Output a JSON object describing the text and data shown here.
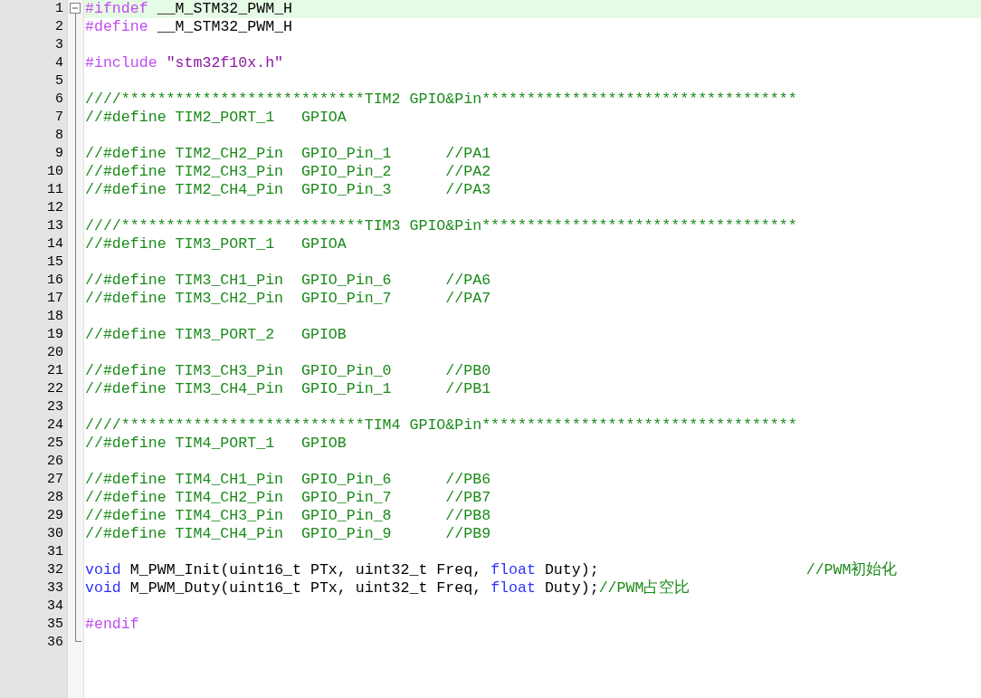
{
  "fold_region": {
    "expanded": true
  },
  "lines": [
    {
      "number": "1",
      "highlighted": true,
      "tokens": [
        {
          "kind": "preprocessor",
          "text": "#ifndef"
        },
        {
          "kind": "plain",
          "text": " __M_STM32_PWM_H"
        }
      ]
    },
    {
      "number": "2",
      "highlighted": false,
      "tokens": [
        {
          "kind": "preprocessor",
          "text": "#define"
        },
        {
          "kind": "plain",
          "text": " __M_STM32_PWM_H"
        }
      ]
    },
    {
      "number": "3",
      "highlighted": false
    },
    {
      "number": "4",
      "highlighted": false,
      "tokens": [
        {
          "kind": "preprocessor",
          "text": "#include "
        },
        {
          "kind": "string",
          "text": "\"stm32f10x.h\""
        }
      ]
    },
    {
      "number": "5",
      "highlighted": false
    },
    {
      "number": "6",
      "highlighted": false,
      "tokens": [
        {
          "kind": "comment",
          "text": "////***************************TIM2 GPIO&Pin***********************************"
        }
      ]
    },
    {
      "number": "7",
      "highlighted": false,
      "tokens": [
        {
          "kind": "comment",
          "text": "//#define TIM2_PORT_1   GPIOA"
        }
      ]
    },
    {
      "number": "8",
      "highlighted": false
    },
    {
      "number": "9",
      "highlighted": false,
      "tokens": [
        {
          "kind": "comment",
          "text": "//#define TIM2_CH2_Pin  GPIO_Pin_1      //PA1"
        }
      ]
    },
    {
      "number": "10",
      "highlighted": false,
      "tokens": [
        {
          "kind": "comment",
          "text": "//#define TIM2_CH3_Pin  GPIO_Pin_2      //PA2"
        }
      ]
    },
    {
      "number": "11",
      "highlighted": false,
      "tokens": [
        {
          "kind": "comment",
          "text": "//#define TIM2_CH4_Pin  GPIO_Pin_3      //PA3"
        }
      ]
    },
    {
      "number": "12",
      "highlighted": false
    },
    {
      "number": "13",
      "highlighted": false,
      "tokens": [
        {
          "kind": "comment",
          "text": "////***************************TIM3 GPIO&Pin***********************************"
        }
      ]
    },
    {
      "number": "14",
      "highlighted": false,
      "tokens": [
        {
          "kind": "comment",
          "text": "//#define TIM3_PORT_1   GPIOA"
        }
      ]
    },
    {
      "number": "15",
      "highlighted": false
    },
    {
      "number": "16",
      "highlighted": false,
      "tokens": [
        {
          "kind": "comment",
          "text": "//#define TIM3_CH1_Pin  GPIO_Pin_6      //PA6"
        }
      ]
    },
    {
      "number": "17",
      "highlighted": false,
      "tokens": [
        {
          "kind": "comment",
          "text": "//#define TIM3_CH2_Pin  GPIO_Pin_7      //PA7"
        }
      ]
    },
    {
      "number": "18",
      "highlighted": false
    },
    {
      "number": "19",
      "highlighted": false,
      "tokens": [
        {
          "kind": "comment",
          "text": "//#define TIM3_PORT_2   GPIOB"
        }
      ]
    },
    {
      "number": "20",
      "highlighted": false
    },
    {
      "number": "21",
      "highlighted": false,
      "tokens": [
        {
          "kind": "comment",
          "text": "//#define TIM3_CH3_Pin  GPIO_Pin_0      //PB0"
        }
      ]
    },
    {
      "number": "22",
      "highlighted": false,
      "tokens": [
        {
          "kind": "comment",
          "text": "//#define TIM3_CH4_Pin  GPIO_Pin_1      //PB1"
        }
      ]
    },
    {
      "number": "23",
      "highlighted": false
    },
    {
      "number": "24",
      "highlighted": false,
      "tokens": [
        {
          "kind": "comment",
          "text": "////***************************TIM4 GPIO&Pin***********************************"
        }
      ]
    },
    {
      "number": "25",
      "highlighted": false,
      "tokens": [
        {
          "kind": "comment",
          "text": "//#define TIM4_PORT_1   GPIOB"
        }
      ]
    },
    {
      "number": "26",
      "highlighted": false
    },
    {
      "number": "27",
      "highlighted": false,
      "tokens": [
        {
          "kind": "comment",
          "text": "//#define TIM4_CH1_Pin  GPIO_Pin_6      //PB6"
        }
      ]
    },
    {
      "number": "28",
      "highlighted": false,
      "tokens": [
        {
          "kind": "comment",
          "text": "//#define TIM4_CH2_Pin  GPIO_Pin_7      //PB7"
        }
      ]
    },
    {
      "number": "29",
      "highlighted": false,
      "tokens": [
        {
          "kind": "comment",
          "text": "//#define TIM4_CH3_Pin  GPIO_Pin_8      //PB8"
        }
      ]
    },
    {
      "number": "30",
      "highlighted": false,
      "tokens": [
        {
          "kind": "comment",
          "text": "//#define TIM4_CH4_Pin  GPIO_Pin_9      //PB9"
        }
      ]
    },
    {
      "number": "31",
      "highlighted": false
    },
    {
      "number": "32",
      "highlighted": false,
      "tokens": [
        {
          "kind": "keyword",
          "text": "void"
        },
        {
          "kind": "plain",
          "text": " M_PWM_Init(uint16_t PTx, uint32_t Freq, "
        },
        {
          "kind": "keyword",
          "text": "float"
        },
        {
          "kind": "plain",
          "text": " Duty);                       "
        },
        {
          "kind": "comment",
          "text": "//PWM初始化"
        }
      ]
    },
    {
      "number": "33",
      "highlighted": false,
      "tokens": [
        {
          "kind": "keyword",
          "text": "void"
        },
        {
          "kind": "plain",
          "text": " M_PWM_Duty(uint16_t PTx, uint32_t Freq, "
        },
        {
          "kind": "keyword",
          "text": "float"
        },
        {
          "kind": "plain",
          "text": " Duty);"
        },
        {
          "kind": "comment",
          "text": "//PWM占空比"
        }
      ]
    },
    {
      "number": "34",
      "highlighted": false
    },
    {
      "number": "35",
      "highlighted": false,
      "tokens": [
        {
          "kind": "preprocessor",
          "text": "#endif"
        }
      ]
    },
    {
      "number": "36",
      "highlighted": false
    }
  ]
}
